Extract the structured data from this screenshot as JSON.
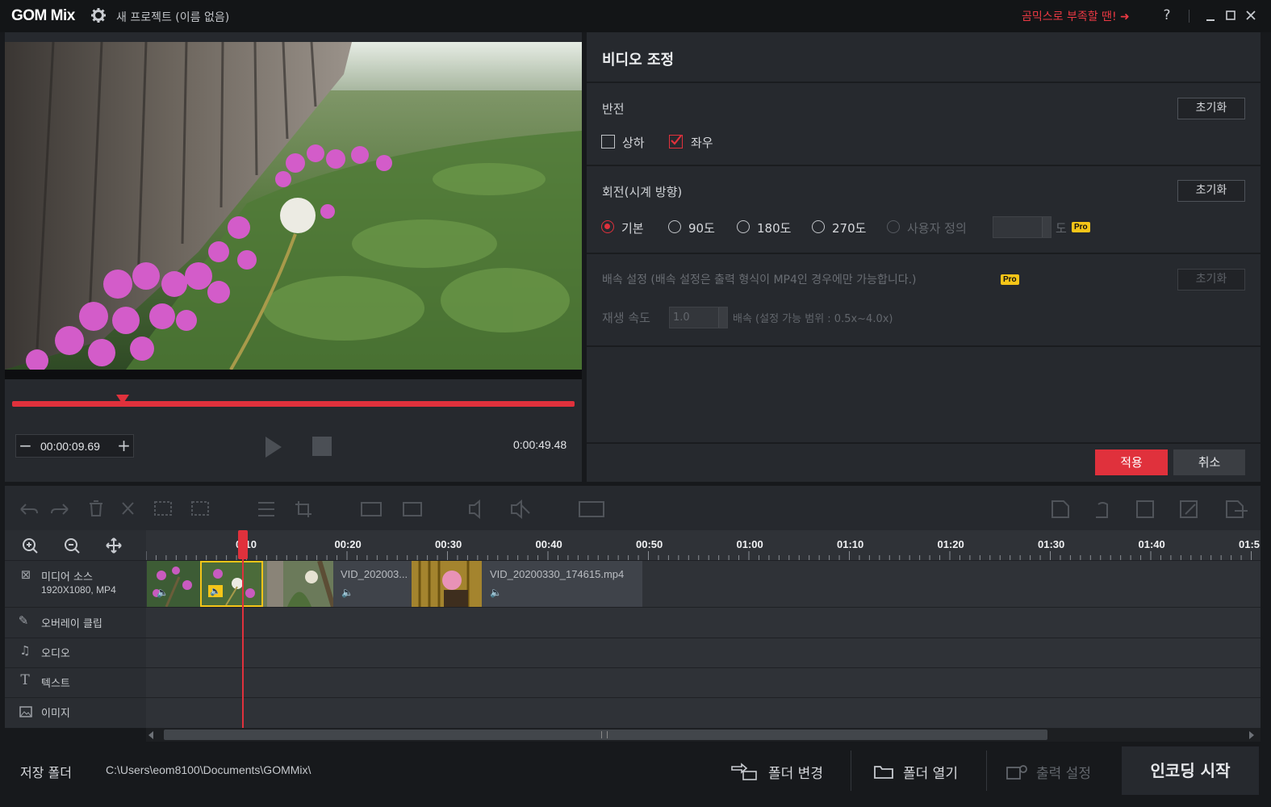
{
  "titlebar": {
    "logo": "GOM Mix",
    "project_name": "새 프로젝트 (이름 없음)",
    "promo_text": "곰믹스로 부족할 땐!",
    "help_label": "?"
  },
  "preview": {
    "current_time": "00:00:09.69",
    "duration": "0:00:49.48",
    "seek_progress": 0.196
  },
  "adjust": {
    "title": "비디오 조정",
    "flip": {
      "heading": "반전",
      "reset_label": "초기화",
      "vertical_label": "상하",
      "vertical_checked": false,
      "horizontal_label": "좌우",
      "horizontal_checked": true
    },
    "rotate": {
      "heading": "회전(시계 방향)",
      "reset_label": "초기화",
      "options": [
        "기본",
        "90도",
        "180도",
        "270도",
        "사용자 정의"
      ],
      "selected": "기본",
      "unit": "도",
      "pro_badge": "Pro"
    },
    "speed": {
      "heading": "배속 설정 (배속 설정은 출력 형식이 MP4인 경우에만 가능합니다.)",
      "pro_badge": "Pro",
      "reset_label": "초기화",
      "rate_label": "재생 속도",
      "rate_value": "1.0",
      "range_label": "배속 (설정 가능 범위 : 0.5x~4.0x)"
    },
    "apply_label": "적용",
    "cancel_label": "취소"
  },
  "timeline": {
    "ruler_ticks": [
      "0:10",
      "00:20",
      "00:30",
      "00:40",
      "00:50",
      "01:00",
      "01:10",
      "01:20",
      "01:30",
      "01:40",
      "01:5"
    ],
    "tracks": [
      {
        "label": "미디어 소스",
        "sublabel": "1920X1080, MP4",
        "icon": "film-icon"
      },
      {
        "label": "오버레이 클립",
        "icon": "overlay-icon"
      },
      {
        "label": "오디오",
        "icon": "music-note-icon"
      },
      {
        "label": "텍스트",
        "icon": "text-icon"
      },
      {
        "label": "이미지",
        "icon": "image-icon"
      }
    ],
    "clip_labels": [
      "VID_202003...",
      "VID_20200330_174615.mp4"
    ]
  },
  "footer": {
    "save_folder_label": "저장 폴더",
    "save_folder_path": "C:\\Users\\eom8100\\Documents\\GOMMix\\",
    "change_folder_label": "폴더 변경",
    "open_folder_label": "폴더 열기",
    "output_settings_label": "출력 설정",
    "encode_label": "인코딩 시작"
  },
  "colors": {
    "accent": "#e0313c",
    "pro_badge": "#f5c518",
    "panel": "#26292e",
    "background": "#17191c"
  }
}
